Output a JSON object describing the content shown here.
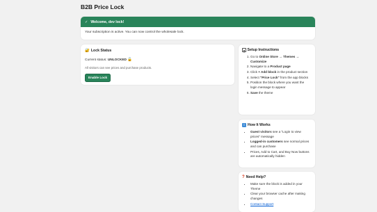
{
  "page": {
    "title": "B2B Price Lock"
  },
  "banner": {
    "icon": "checkmark-icon",
    "title": "Welcome, dev lock!",
    "message": "Your subscription is active. You can now control the wholesale lock."
  },
  "lock_status": {
    "icon": "lock-icon",
    "title": "Lock Status",
    "status_prefix": "Current status:",
    "status_value": "UNLOCKED",
    "status_icon": "unlocked-icon",
    "description": "All visitors can see prices and purchase products.",
    "button_label": "Enable Lock",
    "accent": "#29845a"
  },
  "setup": {
    "title": "Setup Instructions",
    "steps": [
      {
        "pre": "Go to ",
        "bold": "Online Store → Themes → Customize",
        "post": ""
      },
      {
        "pre": "Navigate to a ",
        "bold": "Product page",
        "post": ""
      },
      {
        "pre": "Click ",
        "bold": "+ Add block",
        "post": " in the product section"
      },
      {
        "pre": "Select ",
        "bold": "\"Price Lock\"",
        "post": " from the app blocks"
      },
      {
        "pre": "Position the block where you want the login message to appear",
        "bold": "",
        "post": ""
      },
      {
        "pre": "",
        "bold": "Save",
        "post": " the theme"
      }
    ]
  },
  "how": {
    "title": "How It Works",
    "icon_text": "i",
    "items": [
      {
        "bold": "Guest visitors",
        "post": " see a \"Login to view prices\" message"
      },
      {
        "bold": "Logged-in customers",
        "post": " see normal prices and can purchase"
      },
      {
        "bold": "",
        "post": "Prices, Add to Cart, and Buy Now buttons are automatically hidden"
      }
    ]
  },
  "help": {
    "title": "Need Help?",
    "icon_text": "?",
    "items": [
      "Make sure the block is added in your Theme",
      "Clear your browser cache after making changes"
    ],
    "link_label": "Contact Support"
  }
}
